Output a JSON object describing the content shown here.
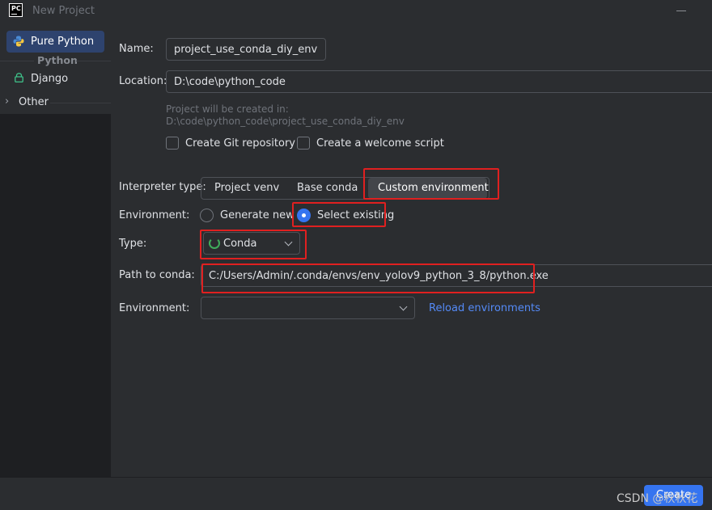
{
  "window": {
    "title": "New Project",
    "logo_text": "PC"
  },
  "sidebar": {
    "items": [
      {
        "label": "Pure Python",
        "icon": "python-icon",
        "selected": true
      },
      {
        "label": "Django",
        "icon": "lock-icon"
      }
    ],
    "group_label": "Python",
    "other_label": "Other"
  },
  "form": {
    "name_label": "Name:",
    "name_value": "project_use_conda_diy_env",
    "location_label": "Location:",
    "location_value": "D:\\code\\python_code",
    "hint_line1": "Project will be created in:",
    "hint_line2": "D:\\code\\python_code\\project_use_conda_diy_env",
    "git_label": "Create Git repository",
    "welcome_label": "Create a welcome script",
    "interpreter_label": "Interpreter type:",
    "interpreter_options": [
      "Project venv",
      "Base conda",
      "Custom environment"
    ],
    "interpreter_selected": "Custom environment",
    "environment_label": "Environment:",
    "env_options": [
      "Generate new",
      "Select existing"
    ],
    "env_selected": "Select existing",
    "type_label": "Type:",
    "type_value": "Conda",
    "path_label": "Path to conda:",
    "path_value": "C:/Users/Admin/.conda/envs/env_yolov9_python_3_8/python.exe",
    "environment2_label": "Environment:",
    "environment2_value": "",
    "reload_label": "Reload environments"
  },
  "footer": {
    "create_label": "Create",
    "watermark": "CSDN @秋秋花"
  },
  "colors": {
    "accent": "#3574f0",
    "highlight": "#e02020",
    "link": "#548af7"
  }
}
